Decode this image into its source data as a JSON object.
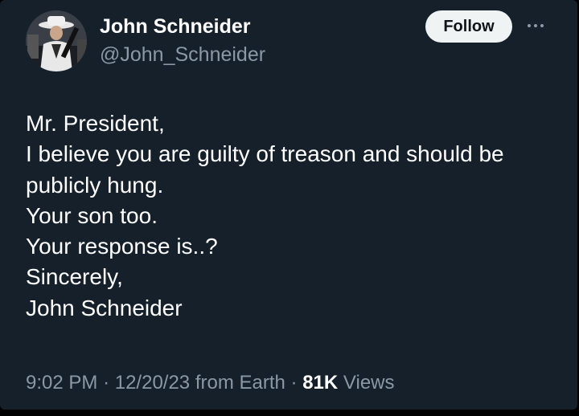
{
  "author": {
    "name": "John Schneider",
    "handle": "@John_Schneider"
  },
  "actions": {
    "follow_label": "Follow",
    "more_icon": "more-horizontal-icon"
  },
  "tweet": {
    "lines": [
      "Mr. President,",
      "I believe you are guilty of treason and should be",
      "publicly hung.",
      "Your son too.",
      "Your response is..?",
      "Sincerely,",
      "John Schneider"
    ]
  },
  "meta": {
    "time": "9:02 PM",
    "separator": "·",
    "date": "12/20/23",
    "source": "from Earth",
    "views_count": "81K",
    "views_label": "Views"
  },
  "colors": {
    "background": "#15202b",
    "text_primary": "#ffffff",
    "text_secondary": "#8b98a5",
    "button_bg": "#eff3f4"
  }
}
